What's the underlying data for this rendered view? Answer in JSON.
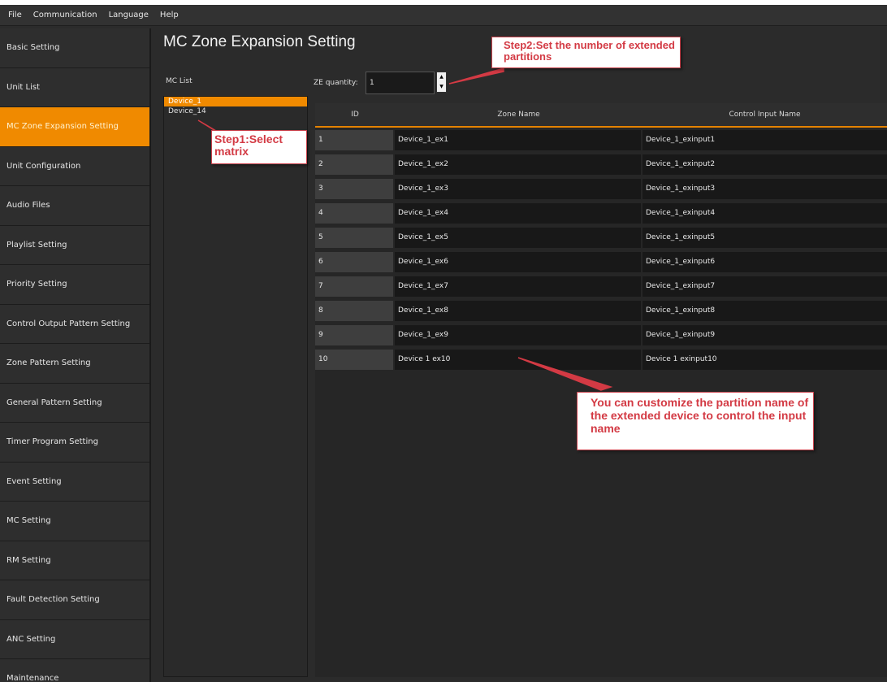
{
  "menubar": {
    "items": [
      "File",
      "Communication",
      "Language",
      "Help"
    ]
  },
  "sidebar": {
    "items": [
      {
        "label": "Basic Setting",
        "active": false
      },
      {
        "label": "Unit List",
        "active": false
      },
      {
        "label": "MC Zone Expansion Setting",
        "active": true
      },
      {
        "label": "Unit Configuration",
        "active": false
      },
      {
        "label": "Audio Files",
        "active": false
      },
      {
        "label": "Playlist Setting",
        "active": false
      },
      {
        "label": "Priority Setting",
        "active": false
      },
      {
        "label": "Control Output Pattern Setting",
        "active": false
      },
      {
        "label": "Zone Pattern Setting",
        "active": false
      },
      {
        "label": "General Pattern Setting",
        "active": false
      },
      {
        "label": "Timer Program Setting",
        "active": false
      },
      {
        "label": "Event Setting",
        "active": false
      },
      {
        "label": "MC Setting",
        "active": false
      },
      {
        "label": "RM Setting",
        "active": false
      },
      {
        "label": "Fault Detection Setting",
        "active": false
      },
      {
        "label": "ANC Setting",
        "active": false
      },
      {
        "label": "Maintenance",
        "active": false
      }
    ]
  },
  "main": {
    "title": "MC Zone Expansion Setting",
    "mc_list": {
      "label": "MC List",
      "items": [
        {
          "label": "Device_1",
          "selected": true
        },
        {
          "label": "Device_14",
          "selected": false
        }
      ]
    },
    "ze_quantity": {
      "label": "ZE quantity:",
      "value": "1"
    },
    "table": {
      "columns": [
        "ID",
        "Zone Name",
        "Control Input Name"
      ],
      "rows": [
        {
          "id": "1",
          "zone": "Device_1_ex1",
          "control": "Device_1_exinput1"
        },
        {
          "id": "2",
          "zone": "Device_1_ex2",
          "control": "Device_1_exinput2"
        },
        {
          "id": "3",
          "zone": "Device_1_ex3",
          "control": "Device_1_exinput3"
        },
        {
          "id": "4",
          "zone": "Device_1_ex4",
          "control": "Device_1_exinput4"
        },
        {
          "id": "5",
          "zone": "Device_1_ex5",
          "control": "Device_1_exinput5"
        },
        {
          "id": "6",
          "zone": "Device_1_ex6",
          "control": "Device_1_exinput6"
        },
        {
          "id": "7",
          "zone": "Device_1_ex7",
          "control": "Device_1_exinput7"
        },
        {
          "id": "8",
          "zone": "Device_1_ex8",
          "control": "Device_1_exinput8"
        },
        {
          "id": "9",
          "zone": "Device_1_ex9",
          "control": "Device_1_exinput9"
        },
        {
          "id": "10",
          "zone": "Device 1 ex10",
          "control": "Device 1 exinput10"
        }
      ]
    }
  },
  "annotations": {
    "step1": "Step1:Select matrix",
    "step2": "Step2:Set the number of extended partitions",
    "customize": "You can customize the partition name of the extended device to control the input name",
    "color": "#d33a44"
  },
  "colors": {
    "accent": "#f08a00",
    "background": "#2b2b2b",
    "cell_background": "#181818"
  }
}
